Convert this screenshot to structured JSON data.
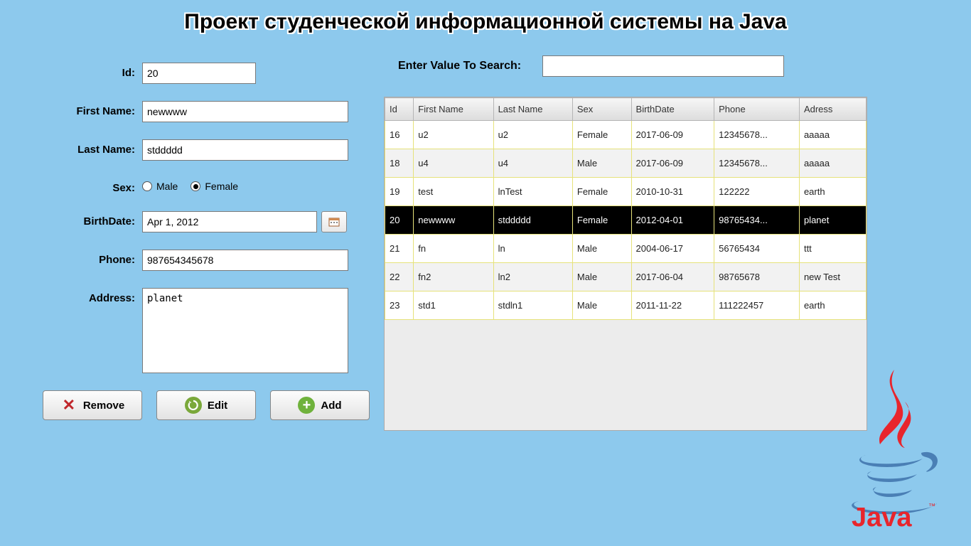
{
  "title": "Проект студенческой информационной системы на Java",
  "form": {
    "labels": {
      "id": "Id:",
      "firstName": "First Name:",
      "lastName": "Last Name:",
      "sex": "Sex:",
      "birthDate": "BirthDate:",
      "phone": "Phone:",
      "address": "Address:"
    },
    "values": {
      "id": "20",
      "firstName": "newwww",
      "lastName": "stddddd",
      "birthDate": "Apr 1, 2012",
      "phone": "987654345678",
      "address": "planet"
    },
    "sexOptions": {
      "male": "Male",
      "female": "Female",
      "selected": "female"
    }
  },
  "buttons": {
    "remove": "Remove",
    "edit": "Edit",
    "add": "Add"
  },
  "search": {
    "label": "Enter Value To Search:",
    "value": ""
  },
  "table": {
    "headers": [
      "Id",
      "First Name",
      "Last Name",
      "Sex",
      "BirthDate",
      "Phone",
      "Adress"
    ],
    "selectedId": "20",
    "rows": [
      {
        "id": "16",
        "firstName": "u2",
        "lastName": "u2",
        "sex": "Female",
        "birthDate": "2017-06-09",
        "phone": "12345678...",
        "address": "aaaaa"
      },
      {
        "id": "18",
        "firstName": "u4",
        "lastName": "u4",
        "sex": "Male",
        "birthDate": "2017-06-09",
        "phone": "12345678...",
        "address": "aaaaa"
      },
      {
        "id": "19",
        "firstName": "test",
        "lastName": "lnTest",
        "sex": "Female",
        "birthDate": "2010-10-31",
        "phone": "122222",
        "address": "earth"
      },
      {
        "id": "20",
        "firstName": "newwww",
        "lastName": "stddddd",
        "sex": "Female",
        "birthDate": "2012-04-01",
        "phone": "98765434...",
        "address": "planet"
      },
      {
        "id": "21",
        "firstName": "fn",
        "lastName": "ln",
        "sex": "Male",
        "birthDate": "2004-06-17",
        "phone": "56765434",
        "address": "ttt"
      },
      {
        "id": "22",
        "firstName": "fn2",
        "lastName": "ln2",
        "sex": "Male",
        "birthDate": "2017-06-04",
        "phone": "98765678",
        "address": "new Test"
      },
      {
        "id": "23",
        "firstName": "std1",
        "lastName": "stdln1",
        "sex": "Male",
        "birthDate": "2011-11-22",
        "phone": "111222457",
        "address": "earth"
      }
    ]
  },
  "logo": {
    "text": "Java"
  }
}
